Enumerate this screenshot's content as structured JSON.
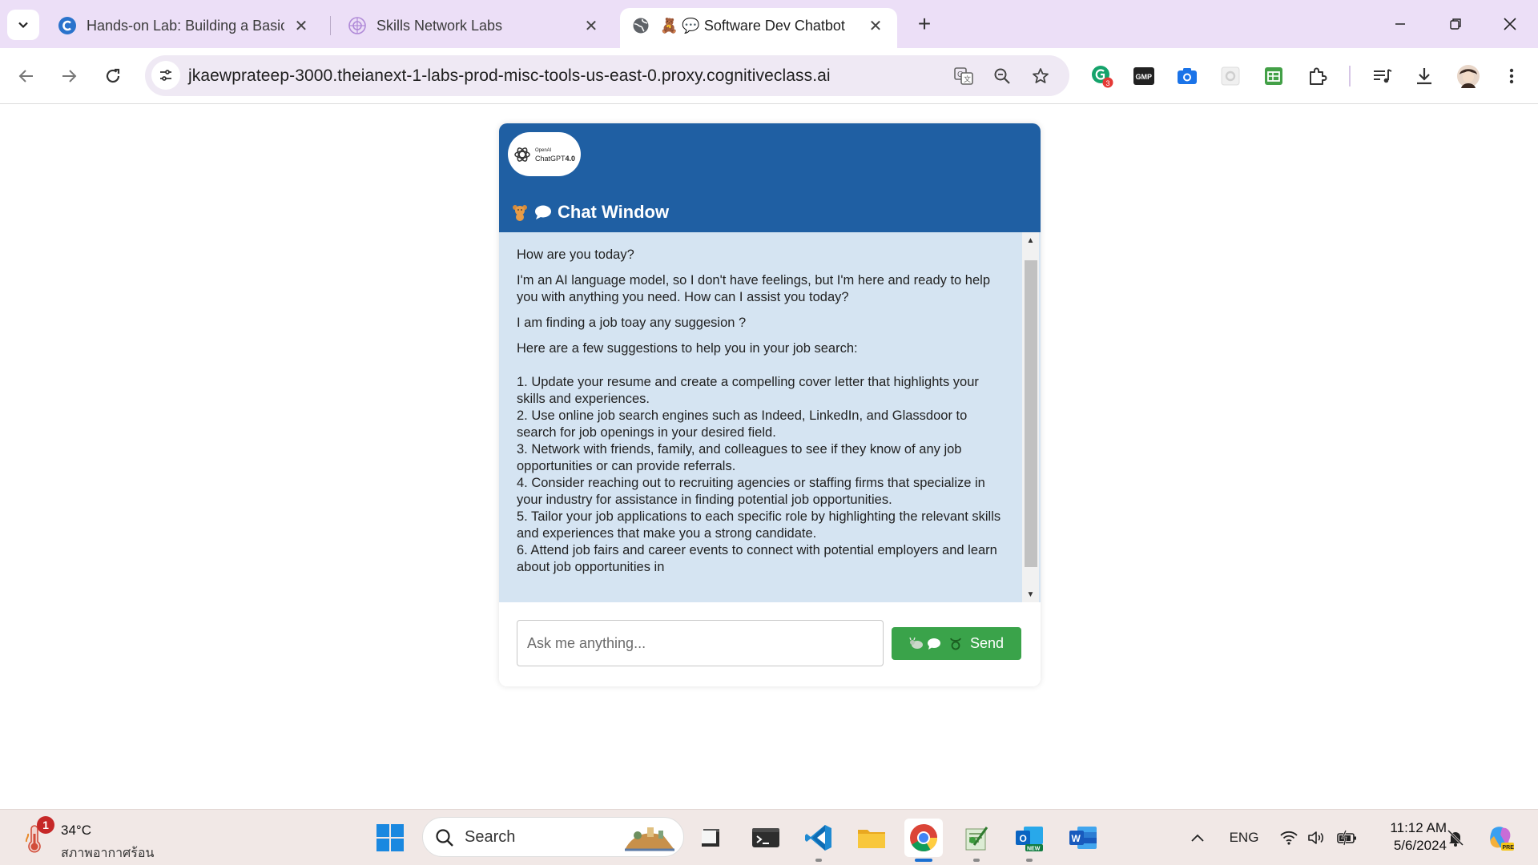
{
  "browser": {
    "tabs": [
      {
        "title": "Hands-on Lab: Building a Basic",
        "favicon": "coursera-icon",
        "active": false
      },
      {
        "title": "Skills Network Labs",
        "favicon": "skills-network-icon",
        "active": false
      },
      {
        "title": "🧸 💬 Software Dev Chatbot",
        "favicon": "globe-icon",
        "active": true
      }
    ],
    "url": "jkaewprateep-3000.theianext-1-labs-prod-misc-tools-us-east-0.proxy.cognitiveclass.ai",
    "extension_badge": "3",
    "extensions": [
      "grammarly-icon",
      "gmp-icon",
      "camera-icon",
      "settings-icon",
      "sheets-icon",
      "puzzle-icon"
    ]
  },
  "chat": {
    "logo": {
      "line1": "OpenAI",
      "line2": "ChatGPT",
      "version": "4.0"
    },
    "title_emojis": "🧸 💬",
    "title": "Chat Window",
    "messages": [
      {
        "role": "user",
        "text": "How are you today?"
      },
      {
        "role": "bot",
        "text": "I'm an AI language model, so I don't have feelings, but I'm here and ready to help you with anything you need. How can I assist you today?"
      },
      {
        "role": "user",
        "text": "I am finding a job toay any suggesion ?"
      },
      {
        "role": "bot",
        "text": "Here are a few suggestions to help you in your job search:\n\n1. Update your resume and create a compelling cover letter that highlights your skills and experiences.\n2. Use online job search engines such as Indeed, LinkedIn, and Glassdoor to search for job openings in your desired field.\n3. Network with friends, family, and colleagues to see if they know of any job opportunities or can provide referrals.\n4. Consider reaching out to recruiting agencies or staffing firms that specialize in your industry for assistance in finding potential job opportunities.\n5. Tailor your job applications to each specific role by highlighting the relevant skills and experiences that make you a strong candidate.\n6. Attend job fairs and career events to connect with potential employers and learn about job opportunities in"
      }
    ],
    "input_placeholder": "Ask me anything...",
    "send_label": "Send",
    "send_emojis": "🐂💬 ♉",
    "colors": {
      "header": "#1f5fa3",
      "messages_bg": "#d5e4f2",
      "send": "#3aa34a"
    }
  },
  "taskbar": {
    "weather": {
      "badge": "1",
      "temp": "34°C",
      "desc": "สภาพอากาศร้อน"
    },
    "search_label": "Search",
    "apps": [
      "file-explorer-icon",
      "terminal-icon",
      "vscode-icon",
      "folder-icon",
      "chrome-icon",
      "notepad-icon",
      "outlook-new-icon",
      "word-icon"
    ],
    "lang": "ENG",
    "time": "11:12 AM",
    "date": "5/6/2024"
  }
}
